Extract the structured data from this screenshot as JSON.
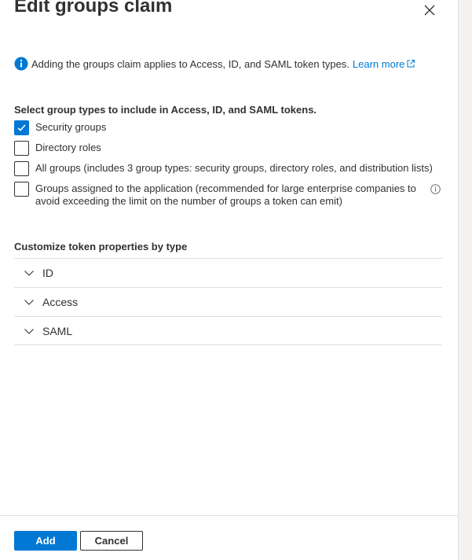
{
  "panel": {
    "title": "Edit groups claim",
    "close_icon": "close-icon"
  },
  "info": {
    "icon": "info-icon",
    "text": "Adding the groups claim applies to Access, ID, and SAML token types.",
    "link_text": "Learn more",
    "link_icon": "external-link-icon"
  },
  "group_types": {
    "label": "Select group types to include in Access, ID, and SAML tokens.",
    "options": [
      {
        "label": "Security groups",
        "checked": true
      },
      {
        "label": "Directory roles",
        "checked": false
      },
      {
        "label": "All groups (includes 3 group types: security groups, directory roles, and distribution lists)",
        "checked": false
      },
      {
        "label": "Groups assigned to the application (recommended for large enterprise companies to avoid exceeding the limit on the number of groups a token can emit)",
        "checked": false
      }
    ]
  },
  "customize": {
    "label": "Customize token properties by type",
    "items": [
      {
        "label": "ID"
      },
      {
        "label": "Access"
      },
      {
        "label": "SAML"
      }
    ]
  },
  "footer": {
    "add_label": "Add",
    "cancel_label": "Cancel"
  },
  "colors": {
    "accent": "#0078d4",
    "text": "#323130",
    "divider": "#e1dfdd"
  }
}
